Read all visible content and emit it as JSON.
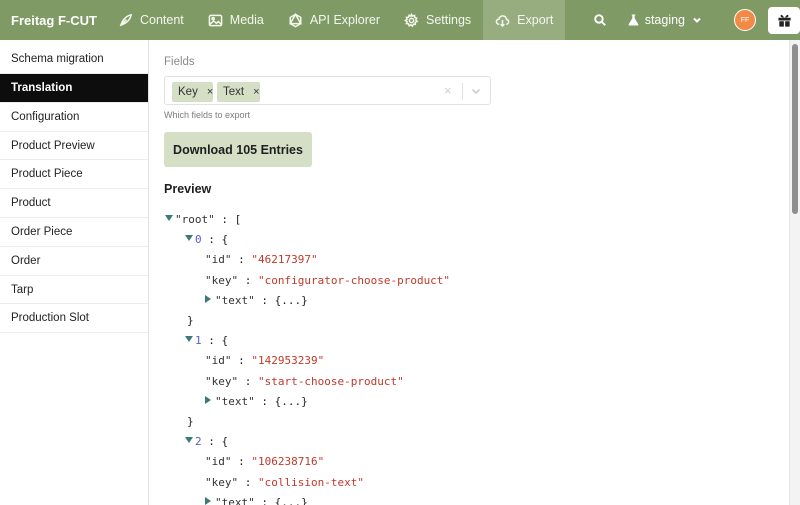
{
  "header": {
    "brand": "Freitag F-CUT",
    "nav": [
      {
        "label": "Content",
        "icon": "feather-icon"
      },
      {
        "label": "Media",
        "icon": "image-icon"
      },
      {
        "label": "API Explorer",
        "icon": "graphql-icon"
      },
      {
        "label": "Settings",
        "icon": "gear-icon"
      },
      {
        "label": "Export",
        "icon": "cloud-download-icon",
        "active": true
      }
    ],
    "environment": "staging",
    "avatar_initials": "FF"
  },
  "sidebar": {
    "items": [
      {
        "label": "Schema migration"
      },
      {
        "label": "Translation",
        "active": true
      },
      {
        "label": "Configuration"
      },
      {
        "label": "Product Preview"
      },
      {
        "label": "Product Piece"
      },
      {
        "label": "Product"
      },
      {
        "label": "Order Piece"
      },
      {
        "label": "Order"
      },
      {
        "label": "Tarp"
      },
      {
        "label": "Production Slot"
      }
    ]
  },
  "main": {
    "fields_label": "Fields",
    "chips": [
      "Key",
      "Text"
    ],
    "chip_remove": "×",
    "hint": "Which fields to export",
    "download_label": "Download 105 Entries",
    "preview_label": "Preview",
    "tree": {
      "root_key": "\"root\"",
      "entries": [
        {
          "index": "0",
          "id": "\"46217397\"",
          "key": "\"configurator-choose-product\""
        },
        {
          "index": "1",
          "id": "\"142953239\"",
          "key": "\"start-choose-product\""
        },
        {
          "index": "2",
          "id": "\"106238716\"",
          "key": "\"collision-text\""
        }
      ],
      "id_label": "\"id\"",
      "key_label": "\"key\"",
      "text_label": "\"text\"",
      "collapsed": "{...}"
    }
  },
  "colors": {
    "topbar": "#7f9a65",
    "chip": "#d5dfc6",
    "string": "#c0392b",
    "index": "#5560c8"
  }
}
